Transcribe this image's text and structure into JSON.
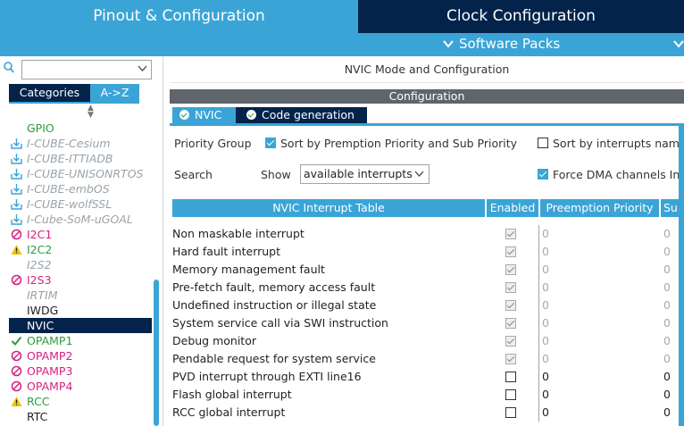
{
  "top_tabs": {
    "pinout": "Pinout & Configuration",
    "clock": "Clock Configuration"
  },
  "software_packs": {
    "label": "Software Packs"
  },
  "left": {
    "search": {
      "value": "",
      "placeholder": ""
    },
    "tabs": {
      "categories": "Categories",
      "az": "A->Z"
    },
    "items": [
      {
        "label": "GPIO",
        "style": "green",
        "icon": "none"
      },
      {
        "label": "I-CUBE-Cesium",
        "style": "gray",
        "icon": "download-icon"
      },
      {
        "label": "I-CUBE-ITTIADB",
        "style": "gray",
        "icon": "download-icon"
      },
      {
        "label": "I-CUBE-UNISONRTOS",
        "style": "gray",
        "icon": "download-icon"
      },
      {
        "label": "I-CUBE-embOS",
        "style": "gray",
        "icon": "download-icon"
      },
      {
        "label": "I-CUBE-wolfSSL",
        "style": "gray",
        "icon": "download-icon"
      },
      {
        "label": "I-Cube-SoM-uGOAL",
        "style": "gray",
        "icon": "download-icon"
      },
      {
        "label": "I2C1",
        "style": "pink",
        "icon": "disabled-icon"
      },
      {
        "label": "I2C2",
        "style": "green",
        "icon": "warning-icon"
      },
      {
        "label": "I2S2",
        "style": "gray",
        "icon": "none"
      },
      {
        "label": "I2S3",
        "style": "pink",
        "icon": "disabled-icon"
      },
      {
        "label": "IRTIM",
        "style": "gray",
        "icon": "none"
      },
      {
        "label": "IWDG",
        "style": "dark",
        "icon": "none"
      },
      {
        "label": "NVIC",
        "style": "selected",
        "icon": "none"
      },
      {
        "label": "OPAMP1",
        "style": "green",
        "icon": "check-icon"
      },
      {
        "label": "OPAMP2",
        "style": "pink",
        "icon": "disabled-icon"
      },
      {
        "label": "OPAMP3",
        "style": "pink",
        "icon": "disabled-icon"
      },
      {
        "label": "OPAMP4",
        "style": "pink",
        "icon": "disabled-icon"
      },
      {
        "label": "RCC",
        "style": "green",
        "icon": "warning-icon"
      },
      {
        "label": "RTC",
        "style": "dark",
        "icon": "none"
      }
    ]
  },
  "right": {
    "title": "NVIC Mode and Configuration",
    "config_bar": "Configuration",
    "subtabs": {
      "nvic": "NVIC",
      "codegen": "Code generation"
    },
    "priority_group_label": "Priority Group",
    "sort_premption_label": "Sort by Premption Priority and Sub Priority",
    "sort_interrupts_label": "Sort by interrupts nam",
    "search_label": "Search",
    "show_label": "Show",
    "show_value": "available interrupts",
    "force_dma_label": "Force DMA channels In",
    "table": {
      "headers": {
        "name": "NVIC Interrupt Table",
        "enabled": "Enabled",
        "preemption": "Preemption Priority",
        "sub": "Su"
      },
      "rows": [
        {
          "name": "Non maskable interrupt",
          "enabled": true,
          "locked": true,
          "pre": "0",
          "sub": "0"
        },
        {
          "name": "Hard fault interrupt",
          "enabled": true,
          "locked": true,
          "pre": "0",
          "sub": "0"
        },
        {
          "name": "Memory management fault",
          "enabled": true,
          "locked": true,
          "pre": "0",
          "sub": "0"
        },
        {
          "name": "Pre-fetch fault, memory access fault",
          "enabled": true,
          "locked": true,
          "pre": "0",
          "sub": "0"
        },
        {
          "name": "Undefined instruction or illegal state",
          "enabled": true,
          "locked": true,
          "pre": "0",
          "sub": "0"
        },
        {
          "name": "System service call via SWI instruction",
          "enabled": true,
          "locked": true,
          "pre": "0",
          "sub": "0"
        },
        {
          "name": "Debug monitor",
          "enabled": true,
          "locked": true,
          "pre": "0",
          "sub": "0"
        },
        {
          "name": "Pendable request for system service",
          "enabled": true,
          "locked": true,
          "pre": "0",
          "sub": "0"
        },
        {
          "name": "PVD interrupt through EXTI line16",
          "enabled": false,
          "locked": false,
          "pre": "0",
          "sub": "0"
        },
        {
          "name": "Flash global interrupt",
          "enabled": false,
          "locked": false,
          "pre": "0",
          "sub": "0"
        },
        {
          "name": "RCC global interrupt",
          "enabled": false,
          "locked": false,
          "pre": "0",
          "sub": "0"
        }
      ]
    }
  }
}
